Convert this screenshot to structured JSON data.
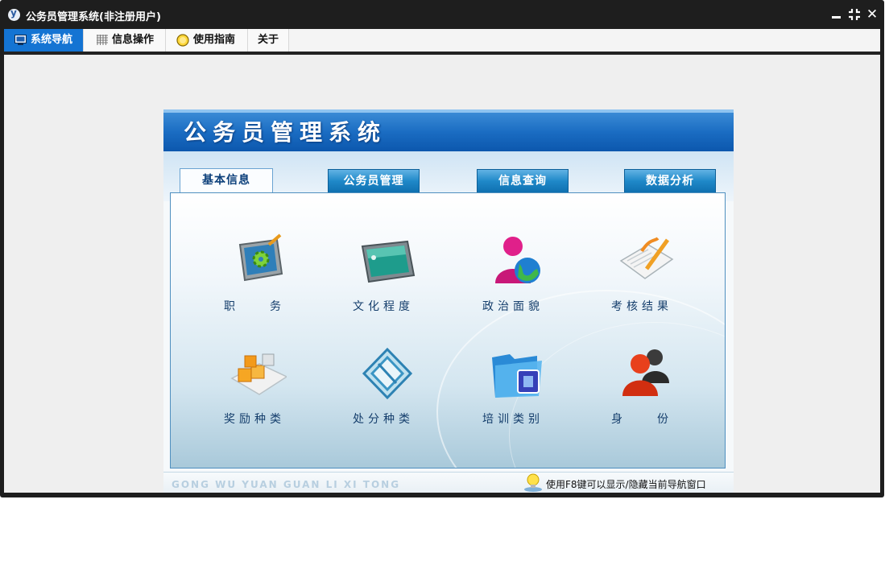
{
  "window": {
    "title": "公务员管理系统(非注册用户)"
  },
  "controls": {
    "minimize": "minimize",
    "restore": "restore",
    "close": "✕"
  },
  "menu_tabs": [
    {
      "label": "系统导航",
      "icon": "monitor-icon",
      "active": true
    },
    {
      "label": "信息操作",
      "icon": "grid-icon",
      "active": false
    },
    {
      "label": "使用指南",
      "icon": "help-coin-icon",
      "active": false
    },
    {
      "label": "关于",
      "icon": "",
      "active": false
    }
  ],
  "banner": {
    "title": "公务员管理系统"
  },
  "content_tabs": [
    {
      "label": "基本信息",
      "active": true
    },
    {
      "label": "公务员管理",
      "active": false
    },
    {
      "label": "信息查询",
      "active": false
    },
    {
      "label": "数据分析",
      "active": false
    }
  ],
  "items": [
    {
      "label": "职　　务",
      "icon": "gear-monitor-icon"
    },
    {
      "label": "文化程度",
      "icon": "tablet-icon"
    },
    {
      "label": "政治面貌",
      "icon": "person-globe-icon"
    },
    {
      "label": "考核结果",
      "icon": "document-pen-icon"
    },
    {
      "label": "奖励种类",
      "icon": "boxes-icon"
    },
    {
      "label": "处分种类",
      "icon": "diamond-icon"
    },
    {
      "label": "培训类别",
      "icon": "folder-icon"
    },
    {
      "label": "身　　份",
      "icon": "people-icon"
    }
  ],
  "footer": {
    "brand_text": "GONG WU YUAN GUAN LI XI TONG",
    "hint": "使用F8键可以显示/隐藏当前导航窗口"
  },
  "colors": {
    "accent": "#1474d3",
    "banner": "#1a6cc2",
    "window_frame": "#1e1e1e"
  }
}
